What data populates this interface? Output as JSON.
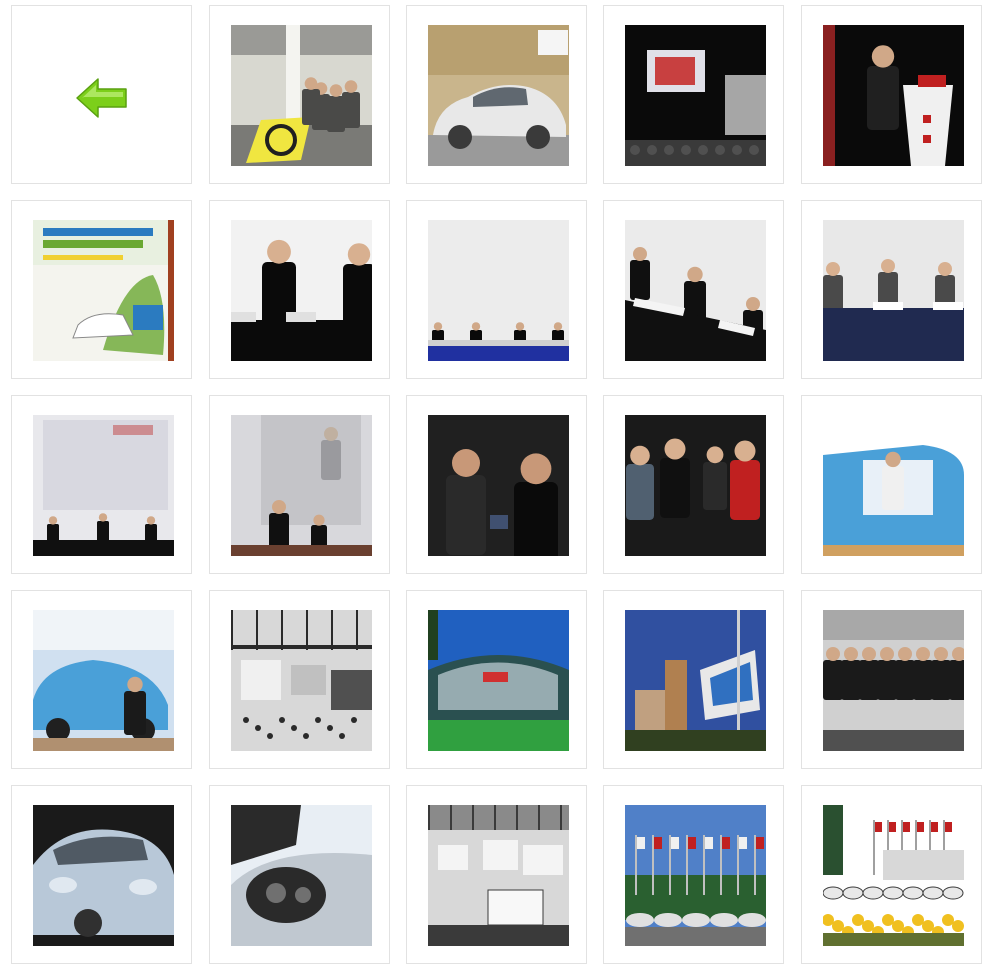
{
  "gallery": {
    "back_icon": "left-arrow-icon",
    "colors": {
      "tile_border": "#e2e2e2",
      "arrow_green": "#7ccf1a"
    },
    "photos": [
      {
        "id": "expo-floor-crowd",
        "scene": "expo",
        "palette": [
          "#d8d8d0",
          "#4a4a48",
          "#bcbcb2",
          "#f0e640"
        ]
      },
      {
        "id": "white-toyota-car",
        "scene": "car",
        "palette": [
          "#c9b58c",
          "#e8e8e8",
          "#f5f5f5",
          "#3a3a3a"
        ]
      },
      {
        "id": "stage-screen-audience",
        "scene": "stage",
        "palette": [
          "#0a0a0a",
          "#3a3a3a",
          "#c84040",
          "#e8e8e8"
        ]
      },
      {
        "id": "speaker-at-podium",
        "scene": "podium",
        "palette": [
          "#0a0a0a",
          "#202020",
          "#f0f0f0",
          "#c02020"
        ]
      },
      {
        "id": "event-poster",
        "scene": "poster",
        "palette": [
          "#f4f4ee",
          "#6aa832",
          "#2b7bc0",
          "#f0d030"
        ]
      },
      {
        "id": "panel-two-men",
        "scene": "panel2",
        "palette": [
          "#f2f2f2",
          "#0a0a0a",
          "#d8b090",
          "#e0e0e0"
        ]
      },
      {
        "id": "panel-wide-screen",
        "scene": "panelwide",
        "palette": [
          "#ececec",
          "#0a0a0a",
          "#2030a0",
          "#d0d0d0"
        ]
      },
      {
        "id": "panel-three-men",
        "scene": "panel3",
        "palette": [
          "#ebebeb",
          "#101010",
          "#d0a888",
          "#f4f4f4"
        ]
      },
      {
        "id": "panel-blue-table",
        "scene": "panelblue",
        "palette": [
          "#e8e8e8",
          "#202a50",
          "#4a4a4a",
          "#d8b090"
        ]
      },
      {
        "id": "panel-faded-screen",
        "scene": "panelfaded",
        "palette": [
          "#e8e8ec",
          "#d8d8e0",
          "#101010",
          "#c04040"
        ]
      },
      {
        "id": "two-men-handshake",
        "scene": "handshake",
        "palette": [
          "#d8d8dc",
          "#6a4030",
          "#101010",
          "#c8c8cc"
        ]
      },
      {
        "id": "two-men-talking",
        "scene": "talking",
        "palette": [
          "#202020",
          "#0a0a0a",
          "#c89878",
          "#405070"
        ]
      },
      {
        "id": "group-conversation",
        "scene": "group",
        "palette": [
          "#1a1a1a",
          "#3a3a3a",
          "#c02020",
          "#d8b090"
        ]
      },
      {
        "id": "blue-leaf-driver",
        "scene": "blueleaf",
        "palette": [
          "#ffffff",
          "#4aa0d8",
          "#e8f0f8",
          "#202020"
        ]
      },
      {
        "id": "blue-leaf-presenter",
        "scene": "leafpresent",
        "palette": [
          "#d0e0f0",
          "#4aa0d8",
          "#ffffff",
          "#202020"
        ]
      },
      {
        "id": "expo-hall-aerial",
        "scene": "hall",
        "palette": [
          "#d8d8d8",
          "#505050",
          "#f0f0f0",
          "#2a2a2a"
        ]
      },
      {
        "id": "modern-building-lawn",
        "scene": "building",
        "palette": [
          "#2060c0",
          "#30a040",
          "#e0e8f0",
          "#ffffff"
        ]
      },
      {
        "id": "monaco-billboard",
        "scene": "monaco",
        "palette": [
          "#3050a0",
          "#e8e8e8",
          "#b08050",
          "#304020"
        ]
      },
      {
        "id": "group-photo-hall",
        "scene": "groupphoto",
        "palette": [
          "#d0d0d0",
          "#1a1a1a",
          "#e8e8e8",
          "#505050"
        ]
      },
      {
        "id": "silver-leaf-front",
        "scene": "silverfront",
        "palette": [
          "#1a1a1a",
          "#b8c8d8",
          "#e0e8f0",
          "#303030"
        ]
      },
      {
        "id": "charging-port",
        "scene": "charging",
        "palette": [
          "#c0c8d0",
          "#2a2a2a",
          "#e8eef4",
          "#707070"
        ]
      },
      {
        "id": "expo-booths-aerial",
        "scene": "booths",
        "palette": [
          "#d8d8d8",
          "#3a3a3a",
          "#f4f4f4",
          "#8a8a8a"
        ]
      },
      {
        "id": "plaza-flags-cars",
        "scene": "plaza",
        "palette": [
          "#5080c8",
          "#e0e0e0",
          "#2a6030",
          "#c02020"
        ]
      },
      {
        "id": "flags-yellow-flowers",
        "scene": "flowers",
        "palette": [
          "#ffffff",
          "#f0c020",
          "#3a3a3a",
          "#c02020"
        ]
      }
    ]
  }
}
